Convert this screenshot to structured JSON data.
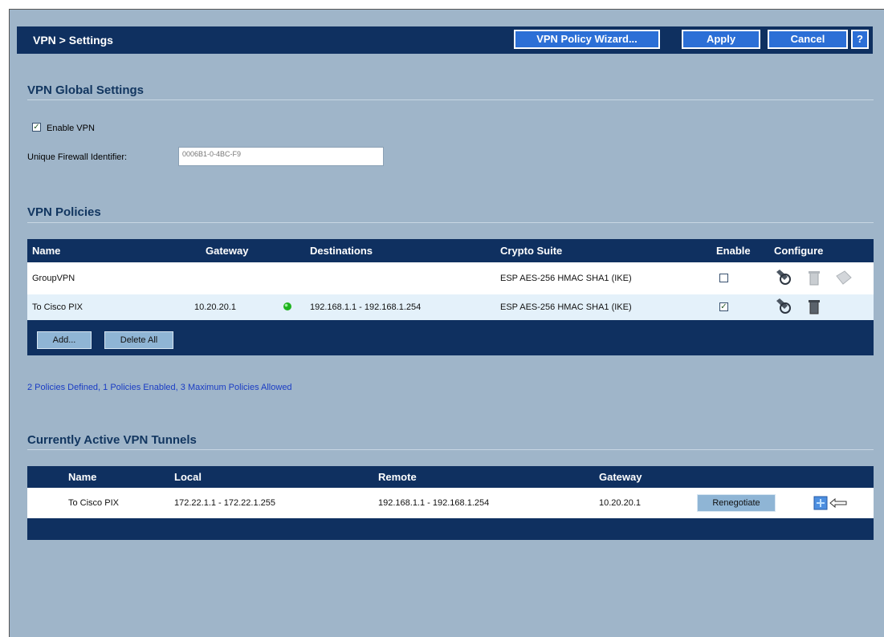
{
  "header": {
    "title": "VPN > Settings",
    "wizard_label": "VPN Policy Wizard...",
    "apply_label": "Apply",
    "cancel_label": "Cancel",
    "help_label": "?"
  },
  "global": {
    "section_title": "VPN Global Settings",
    "enable_vpn_label": "Enable VPN",
    "enable_vpn_checked": true,
    "firewall_id_label": "Unique Firewall Identifier:",
    "firewall_id_value": "0006B1-0-4BC-F9"
  },
  "policies": {
    "section_title": "VPN Policies",
    "columns": [
      "Name",
      "Gateway",
      "Destinations",
      "Crypto Suite",
      "Enable",
      "Configure"
    ],
    "rows": [
      {
        "name": "GroupVPN",
        "gateway": "",
        "destinations": "",
        "crypto": "ESP AES-256 HMAC SHA1 (IKE)",
        "enabled": false
      },
      {
        "name": "To Cisco PIX",
        "gateway": "10.20.20.1",
        "destinations": "192.168.1.1 - 192.168.1.254",
        "crypto": "ESP AES-256 HMAC SHA1 (IKE)",
        "enabled": true
      }
    ],
    "add_label": "Add...",
    "delete_all_label": "Delete All",
    "summary": "2 Policies Defined, 1 Policies Enabled, 3 Maximum Policies Allowed"
  },
  "tunnels": {
    "section_title": "Currently Active VPN Tunnels",
    "columns": [
      "Name",
      "Local",
      "Remote",
      "Gateway"
    ],
    "rows": [
      {
        "name": "To Cisco PIX",
        "local": "172.22.1.1 - 172.22.1.255",
        "remote": "192.168.1.1 - 192.168.1.254",
        "gateway": "10.20.20.1",
        "action": "Renegotiate"
      }
    ]
  },
  "colors": {
    "header_bg": "#0f3060",
    "page_bg": "#9fb5c9",
    "accent_button": "#2c6fd6",
    "status_text": "#1a3cc4"
  }
}
